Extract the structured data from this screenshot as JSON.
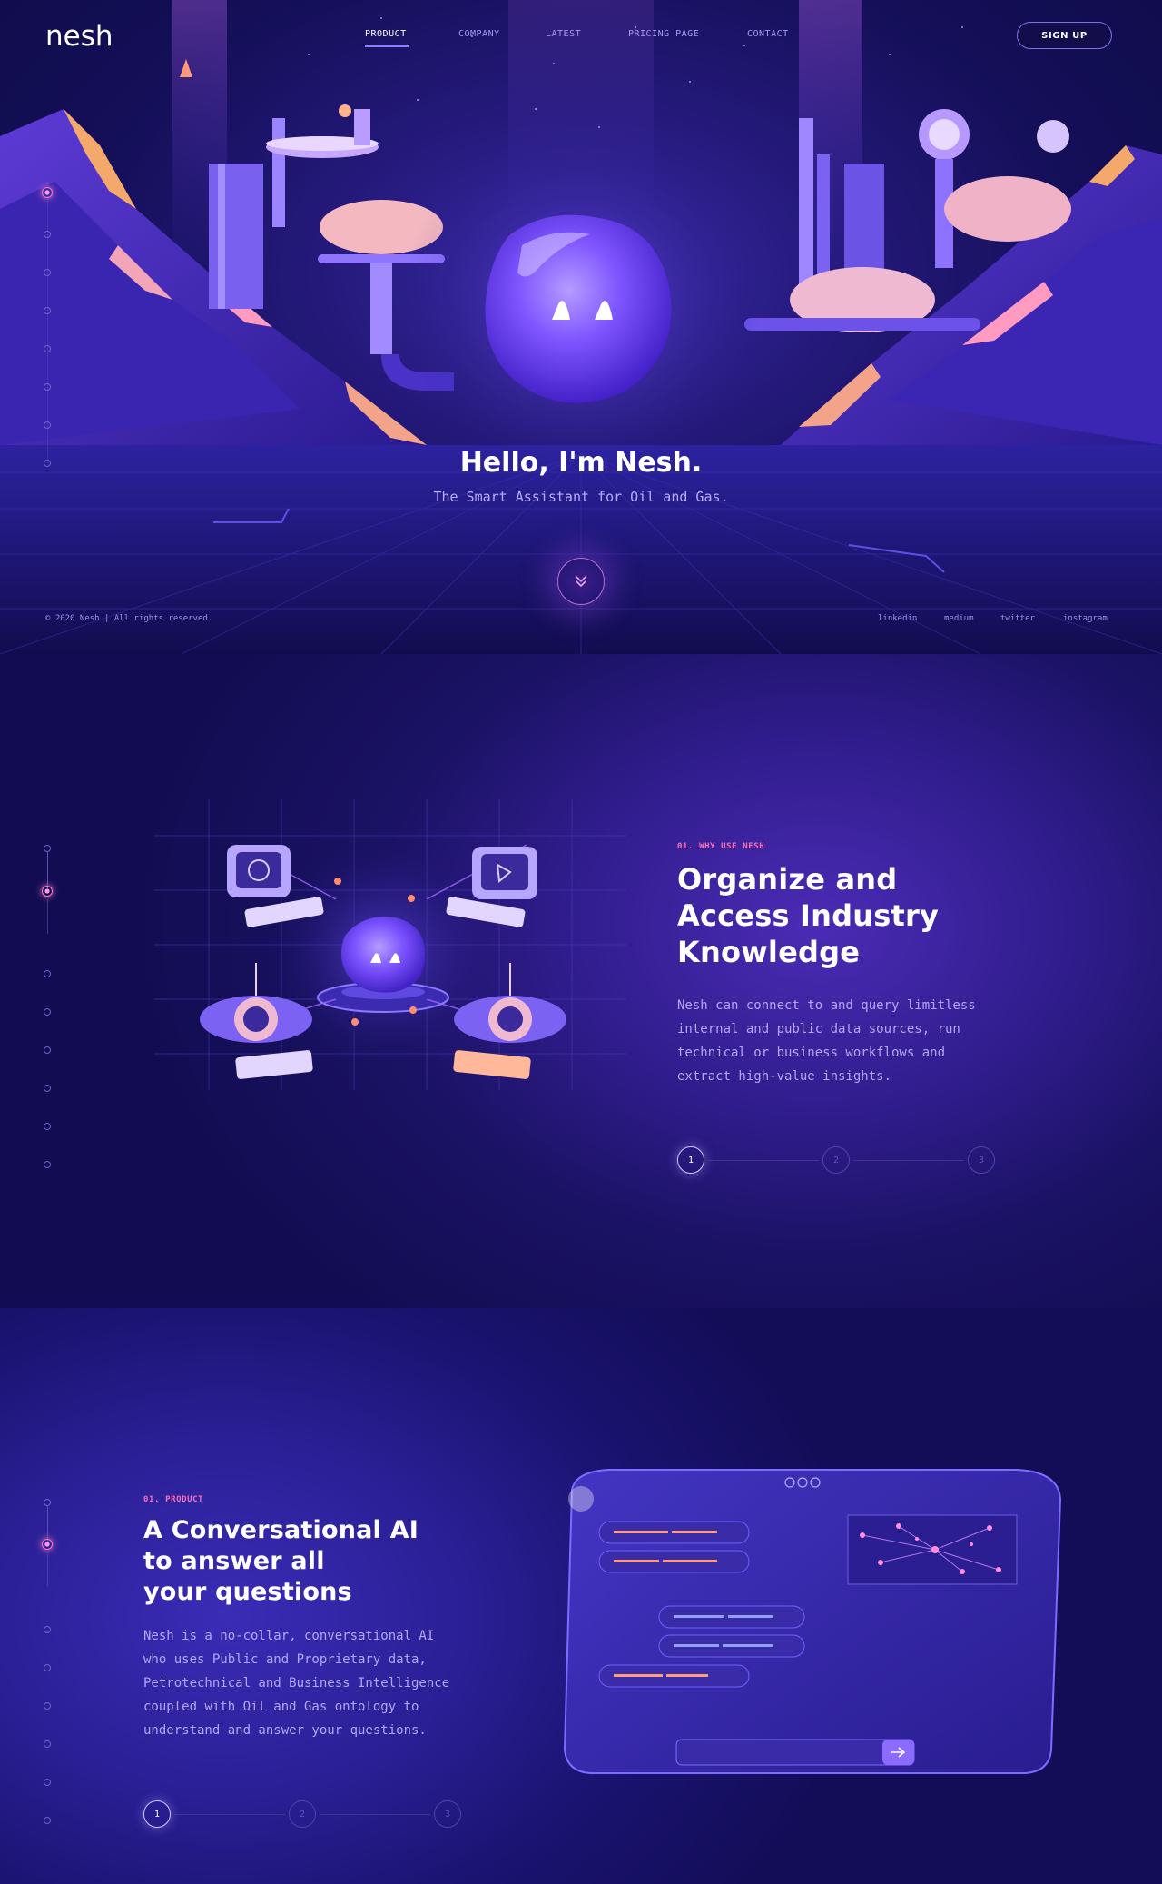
{
  "header": {
    "logo": "nesh",
    "nav": [
      {
        "label": "PRODUCT",
        "active": true
      },
      {
        "label": "COMPANY",
        "active": false
      },
      {
        "label": "LATEST",
        "active": false
      },
      {
        "label": "PRICING PAGE",
        "active": false
      },
      {
        "label": "CONTACT",
        "active": false
      }
    ],
    "signup_label": "SIGN UP"
  },
  "hero": {
    "title": "Hello, I'm Nesh.",
    "subtitle": "The Smart Assistant for Oil and Gas.",
    "copyright": "© 2020 Nesh | All rights reserved.",
    "socials": [
      "linkedin",
      "medium",
      "twitter",
      "instagram"
    ],
    "scroll_icon": "chevron-double-down-icon"
  },
  "why": {
    "eyebrow": "01. WHY USE NESH",
    "title_lines": [
      "Organize and",
      "Access Industry",
      "Knowledge"
    ],
    "body_lines": [
      "Nesh can connect to and query limitless",
      "internal and public data sources, run",
      "technical or business workflows and",
      "extract high-value insights."
    ],
    "steps": [
      "1",
      "2",
      "3"
    ],
    "active_step": 1
  },
  "product": {
    "eyebrow": "01. PRODUCT",
    "title_lines": [
      "A Conversational AI",
      "to answer all",
      "your questions"
    ],
    "body_lines": [
      "Nesh is a no-collar, conversational AI",
      "who uses Public and Proprietary data,",
      "Petrotechnical and Business Intelligence",
      "coupled with Oil and Gas ontology to",
      "understand and answer your questions."
    ],
    "steps": [
      "1",
      "2",
      "3"
    ],
    "active_step": 1
  },
  "colors": {
    "accent_pink": "#ff6fb2",
    "accent_violet": "#8a7dff",
    "background": "#120d52"
  }
}
